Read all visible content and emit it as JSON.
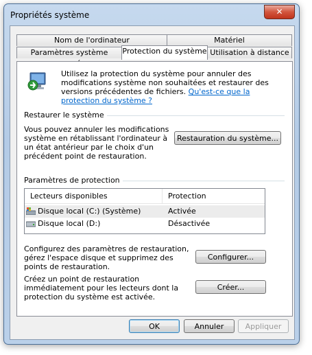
{
  "window": {
    "title": "Propriétés système",
    "close_symbol": "✕"
  },
  "tabs": {
    "row_back": [
      "Nom de l'ordinateur",
      "Matériel"
    ],
    "row_front": [
      "Paramètres système avancés",
      "Protection du système",
      "Utilisation à distance"
    ],
    "active": "Protection du système"
  },
  "intro": {
    "text": "Utilisez la protection du système pour annuler des modifications système non souhaitées et restaurer des versions précédentes de fichiers.",
    "link": "Qu'est-ce que la protection du système ?"
  },
  "restore": {
    "group_label": "Restaurer le système",
    "description": "Vous pouvez annuler les modifications système en rétablissant l'ordinateur à un état antérieur par le choix d'un précédent point de restauration.",
    "button": "Restauration du système..."
  },
  "protection": {
    "group_label": "Paramètres de protection",
    "columns": [
      "Lecteurs disponibles",
      "Protection"
    ],
    "drives": [
      {
        "name": "Disque local (C:) (Système)",
        "status": "Activée",
        "icon": "system-drive-icon"
      },
      {
        "name": "Disque local (D:)",
        "status": "Désactivée",
        "icon": "drive-icon"
      }
    ],
    "configure_text": "Configurez des paramètres de restauration, gérez l'espace disque et supprimez des points de restauration.",
    "configure_button": "Configurer...",
    "create_text": "Créez un point de restauration immédiatement pour les lecteurs dont la protection du système est activée.",
    "create_button": "Créer..."
  },
  "footer": {
    "ok": "OK",
    "cancel": "Annuler",
    "apply": "Appliquer"
  }
}
